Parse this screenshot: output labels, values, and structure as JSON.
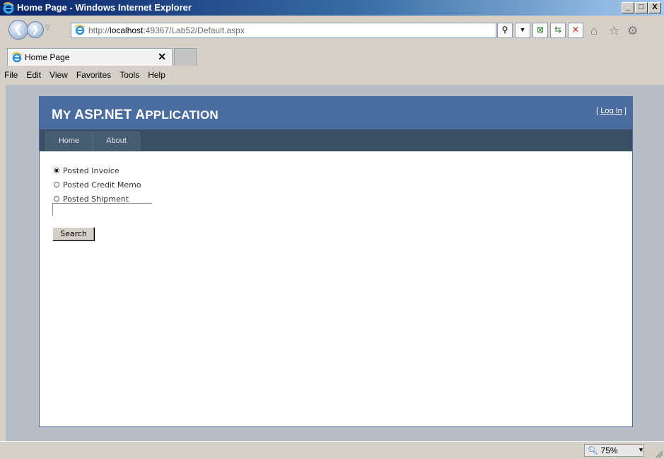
{
  "window": {
    "title": "Home Page - Windows Internet Explorer",
    "minimize": "_",
    "maximize": "□",
    "close": "X"
  },
  "address": {
    "url_prefix": "http://",
    "url_host": "localhost",
    "url_rest": ":49367/Lab52/Default.aspx"
  },
  "tab": {
    "label": "Home Page",
    "close": "✕"
  },
  "menubar": [
    "File",
    "Edit",
    "View",
    "Favorites",
    "Tools",
    "Help"
  ],
  "app": {
    "title_m": "M",
    "title_rest1": "Y ",
    "title_asp": "ASP.NET ",
    "title_a": "A",
    "title_rest2": "PPLICATION",
    "login_left": "[ ",
    "login_link": "Log In",
    "login_right": " ]",
    "nav": [
      "Home",
      "About"
    ]
  },
  "form": {
    "options": [
      "Posted Invoice",
      "Posted Credit Memo",
      "Posted Shipment"
    ],
    "selected_index": 0,
    "search_value": "",
    "search_button": "Search"
  },
  "status": {
    "zoom": "75%"
  },
  "colors": {
    "header": "#4b6c9e",
    "menu": "#3a4f63"
  }
}
